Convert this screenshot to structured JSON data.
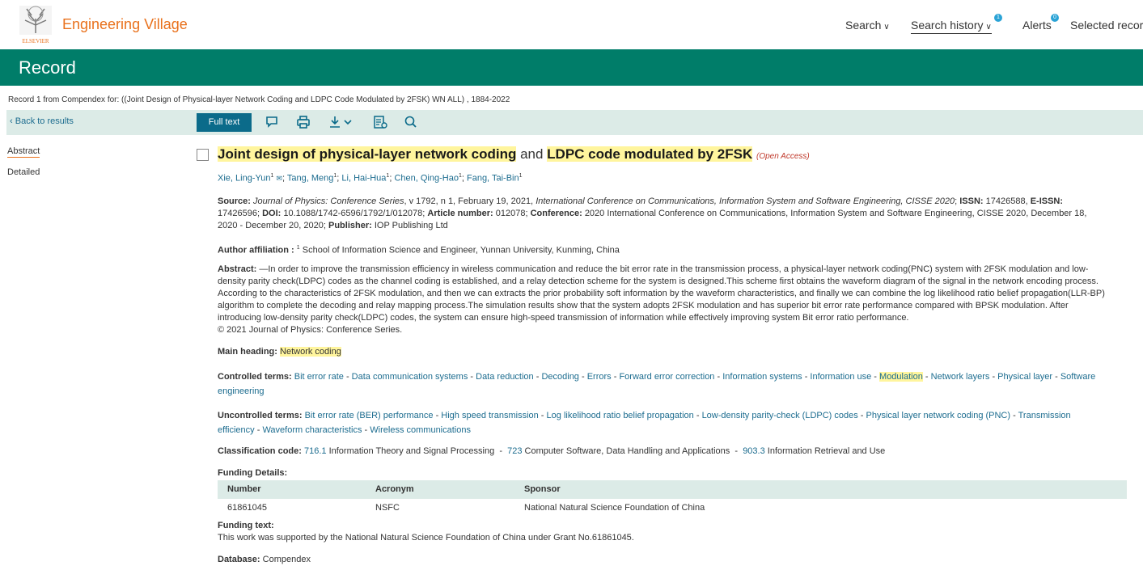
{
  "header": {
    "brand_text": "Engineering Village",
    "logo_caption": "ELSEVIER",
    "nav": [
      {
        "label": "Search",
        "badge": ""
      },
      {
        "label": "Search history",
        "badge": "1"
      },
      {
        "label": "Alerts",
        "badge": "0"
      },
      {
        "label": "Selected record",
        "badge": ""
      }
    ]
  },
  "banner": {
    "title": "Record"
  },
  "record_line": "Record 1 from Compendex for: ((Joint Design of Physical-layer Network Coding and LDPC Code Modulated by 2FSK) WN ALL) , 1884-2022",
  "toolbar": {
    "back_label": "Back to results",
    "fulltext_label": "Full text",
    "icons": [
      "comment-icon",
      "print-icon",
      "download-icon",
      "cite-icon",
      "search-icon"
    ]
  },
  "sidenav": [
    "Abstract",
    "Detailed"
  ],
  "article": {
    "title_parts": [
      "Joint design of physical-layer network coding",
      " and ",
      "LDPC code modulated by 2FSK"
    ],
    "open_access": "(Open Access)",
    "authors": [
      "Xie, Ling-Yun",
      "Tang, Meng",
      "Li, Hai-Hua",
      "Chen, Qing-Hao",
      "Fang, Tai-Bin"
    ],
    "author_sup": "1",
    "source_label": "Source:",
    "source_text_1": "Journal of Physics: Conference Series",
    "source_text_2": ", v 1792, n 1, February 19, 2021,",
    "source_conf": "International Conference on Communications, Information System and Software Engineering, CISSE 2020",
    "issn_label": "ISSN:",
    "issn": "17426588,",
    "eissn_label": "E-ISSN:",
    "eissn": "17426596;",
    "doi_label": "DOI:",
    "doi": "10.1088/1742-6596/1792/1/012078;",
    "article_number_label": "Article number:",
    "article_number": "012078;",
    "conference_label": "Conference:",
    "conference": "2020 International Conference on Communications, Information System and Software Engineering, CISSE 2020, December 18, 2020 - December 20, 2020;",
    "publisher_label": "Publisher:",
    "publisher": "IOP Publishing Ltd",
    "affiliation_label": "Author affiliation :",
    "affiliation_sup": "1",
    "affiliation": "School of Information Science and Engineer, Yunnan University, Kunming, China",
    "abstract_label": "Abstract:",
    "abstract": "—In order to improve the transmission efficiency in wireless communication and reduce the bit error rate in the transmission process, a physical-layer network coding(PNC) system with 2FSK modulation and low-density parity check(LDPC) codes as the channel coding is established, and a relay detection scheme for the system is designed.This scheme first obtains the waveform diagram of the signal in the network encoding process. According to the characteristics of 2FSK modulation, and then we can extracts the prior probability soft information by the waveform characteristics, and finally we can combine the log likelihood ratio belief propagation(LLR-BP) algorithm to complete the decoding and relay mapping process.The simulation results show that the system adopts 2FSK modulation and has superior bit error rate performance compared with BPSK modulation. After introducing low-density parity check(LDPC) codes, the system can ensure high-speed transmission of information while effectively improving system Bit error ratio performance.",
    "copyright": "© 2021 Journal of Physics: Conference Series.",
    "main_heading_label": "Main heading:",
    "main_heading": "Network coding",
    "controlled_label": "Controlled terms:",
    "controlled_terms": [
      "Bit error rate",
      "Data communication systems",
      "Data reduction",
      "Decoding",
      "Errors",
      "Forward error correction",
      "Information systems",
      "Information use",
      "Modulation",
      "Network layers",
      "Physical layer",
      "Software engineering"
    ],
    "uncontrolled_label": "Uncontrolled terms:",
    "uncontrolled_terms": [
      "Bit error rate (BER) performance",
      "High speed transmission",
      "Log likelihood ratio belief propagation",
      "Low-density parity-check (LDPC) codes",
      "Physical layer network coding (PNC)",
      "Transmission efficiency",
      "Waveform characteristics",
      "Wireless communications"
    ],
    "classification_label": "Classification code:",
    "classification": [
      {
        "code": "716.1",
        "desc": "Information Theory and Signal Processing"
      },
      {
        "code": "723",
        "desc": "Computer Software, Data Handling and Applications"
      },
      {
        "code": "903.3",
        "desc": "Information Retrieval and Use"
      }
    ],
    "funding_details_label": "Funding Details:",
    "funding_headers": [
      "Number",
      "Acronym",
      "Sponsor"
    ],
    "funding_rows": [
      [
        "61861045",
        "NSFC",
        "National Natural Science Foundation of China"
      ]
    ],
    "funding_text_label": "Funding text:",
    "funding_text": "This work was supported by the National Natural Science Foundation of China under Grant No.61861045.",
    "database_label": "Database:",
    "database": "Compendex"
  },
  "colors": {
    "accent": "#007d69",
    "brand": "#e9711c",
    "link": "#1c6c8f",
    "highlight": "#fff59d",
    "toolbar": "#dcebe7",
    "button": "#0b6b8a"
  }
}
